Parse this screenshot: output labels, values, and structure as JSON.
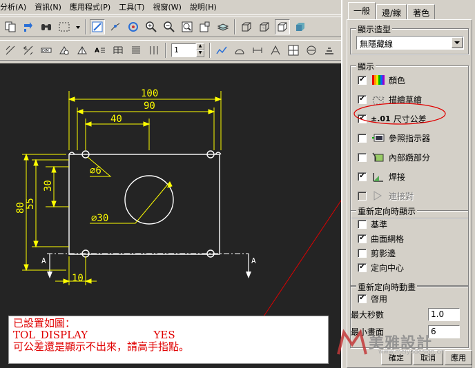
{
  "menu": [
    "分析(A)",
    "資訊(N)",
    "應用程式(P)",
    "工具(T)",
    "視窗(W)",
    "說明(H)"
  ],
  "toolbar": {
    "spin_value": "1"
  },
  "drawing": {
    "dims": {
      "d100": "100",
      "d90": "90",
      "d40": "40",
      "d80": "80",
      "d55": "55",
      "d30v": "30",
      "d10": "10",
      "phi6": "∅6",
      "phi30": "∅30"
    },
    "section_labels": {
      "left": "A",
      "right": "A"
    }
  },
  "note": {
    "line1": "已設置如圖：",
    "line2": "TOL_DISPLAY                    YES",
    "line3": "可公差還是顯示不出來，請高手指點。"
  },
  "panel": {
    "tabs": [
      "一般",
      "邊/線",
      "著色"
    ],
    "display_mode": {
      "title": "顯示造型",
      "selected": "無隱藏線"
    },
    "display": {
      "title": "顯示",
      "items": [
        {
          "label": "顏色",
          "checked": "✔",
          "icon": "color-palette-icon"
        },
        {
          "label": "描繪草繪",
          "checked": "✔",
          "icon": "sketch-icon"
        },
        {
          "label": "尺寸公差",
          "checked": "✔",
          "icon": "tolerance-icon",
          "prefix": "±.01"
        },
        {
          "label": "參照指示器",
          "checked": "",
          "icon": "reference-indicator-icon"
        },
        {
          "label": "內部纜部分",
          "checked": "",
          "icon": "internal-cable-icon"
        },
        {
          "label": "焊接",
          "checked": "✔",
          "icon": "weld-icon"
        },
        {
          "label": "連接對",
          "checked": "",
          "icon": "connection-pair-icon"
        }
      ]
    },
    "reorient_display": {
      "title": "重新定向時顯示",
      "items": [
        {
          "label": "基準",
          "checked": ""
        },
        {
          "label": "曲面網格",
          "checked": "✔"
        },
        {
          "label": "剪影邊",
          "checked": ""
        },
        {
          "label": "定向中心",
          "checked": "✔"
        }
      ]
    },
    "reorient_anim": {
      "title": "重新定向時動畫",
      "enable": {
        "label": "啓用",
        "checked": "✔"
      },
      "max_seconds": {
        "label": "最大秒數",
        "value": "1.0"
      },
      "min_frames": {
        "label": "最小畫面",
        "value": "6"
      }
    },
    "buttons": {
      "ok": "確定",
      "cancel": "取消",
      "apply": "應用"
    }
  },
  "watermark": {
    "text": "美雅設計",
    "url": "www.meiyadesign.cn"
  },
  "colors": {
    "canvas": "#242424",
    "dimension": "#ffff00",
    "geometry": "#ffffff",
    "annotation": "#e00000"
  }
}
